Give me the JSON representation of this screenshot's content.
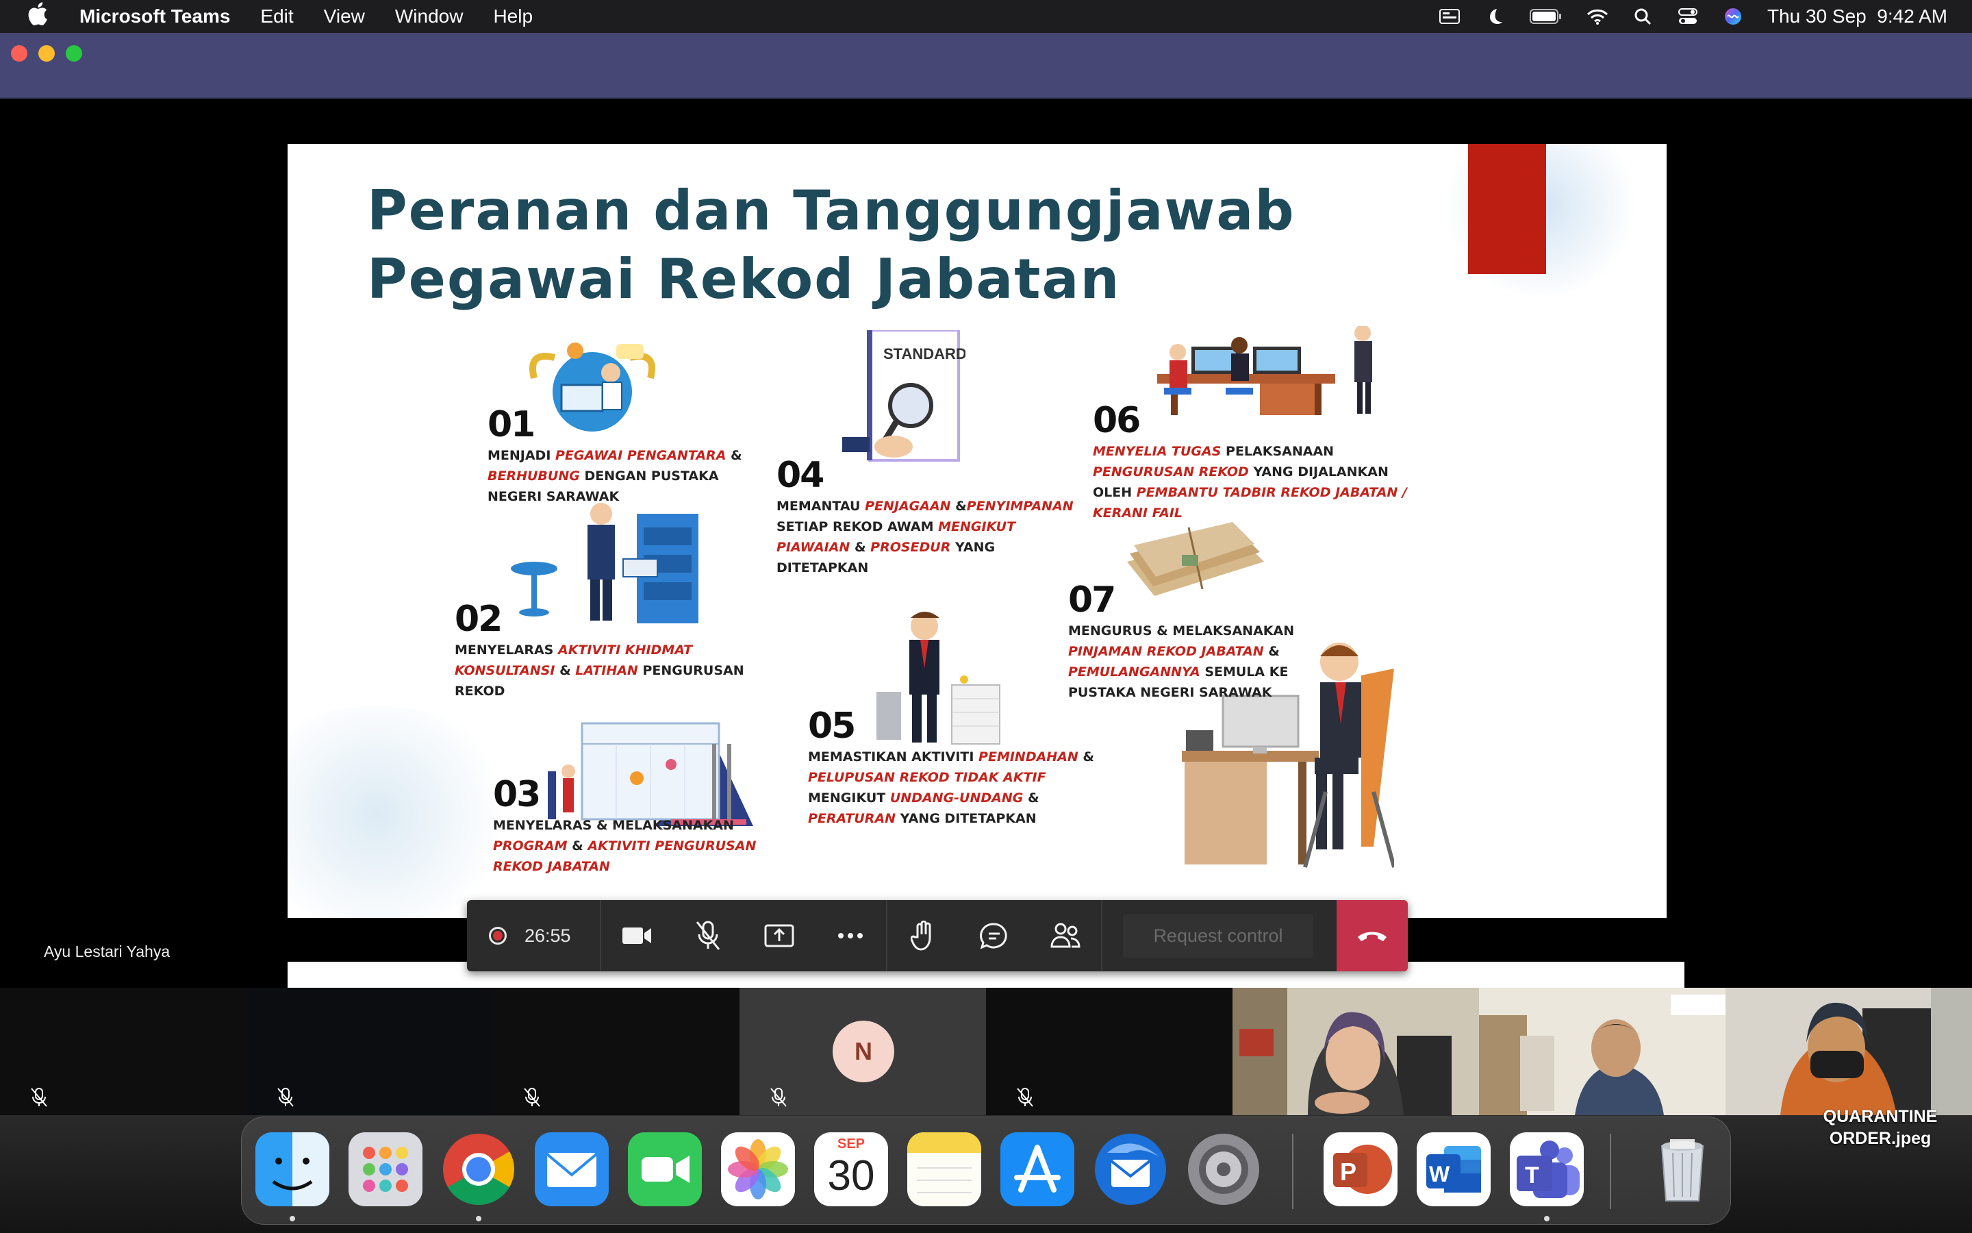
{
  "menubar": {
    "app_name": "Microsoft Teams",
    "menus": [
      "Edit",
      "View",
      "Window",
      "Help"
    ],
    "clock": "Thu 30 Sep  9:42 AM"
  },
  "slide": {
    "title_line1": "Peranan dan Tanggungjawab",
    "title_line2": "Pegawai Rekod Jabatan",
    "standard_label": "STANDARD",
    "items": [
      {
        "num": "01",
        "parts": [
          [
            "MENJADI ",
            0
          ],
          [
            "PEGAWAI PENGANTARA",
            1
          ],
          [
            " & ",
            0
          ],
          [
            "BERHUBUNG",
            1
          ],
          [
            " DENGAN PUSTAKA NEGERI SARAWAK",
            0
          ]
        ]
      },
      {
        "num": "02",
        "parts": [
          [
            "MENYELARAS ",
            0
          ],
          [
            "AKTIVITI KHIDMAT KONSULTANSI",
            1
          ],
          [
            " & ",
            0
          ],
          [
            "LATIHAN",
            1
          ],
          [
            " PENGURUSAN REKOD",
            0
          ]
        ]
      },
      {
        "num": "03",
        "parts": [
          [
            "MENYELARAS & MELAKSANAKAN ",
            0
          ],
          [
            "PROGRAM",
            1
          ],
          [
            " & ",
            0
          ],
          [
            "AKTIVITI PENGURUSAN REKOD JABATAN",
            1
          ]
        ]
      },
      {
        "num": "04",
        "parts": [
          [
            "MEMANTAU ",
            0
          ],
          [
            "PENJAGAAN",
            1
          ],
          [
            " &",
            0
          ],
          [
            "PENYIMPANAN",
            1
          ],
          [
            " SETIAP REKOD AWAM ",
            0
          ],
          [
            "MENGIKUT PIAWAIAN",
            1
          ],
          [
            " & ",
            0
          ],
          [
            "PROSEDUR",
            1
          ],
          [
            " YANG DITETAPKAN",
            0
          ]
        ]
      },
      {
        "num": "05",
        "parts": [
          [
            "MEMASTIKAN AKTIVITI ",
            0
          ],
          [
            "PEMINDAHAN",
            1
          ],
          [
            " & ",
            0
          ],
          [
            "PELUPUSAN REKOD TIDAK AKTIF",
            1
          ],
          [
            " MENGIKUT ",
            0
          ],
          [
            "UNDANG-UNDANG",
            1
          ],
          [
            " & ",
            0
          ],
          [
            "PERATURAN",
            1
          ],
          [
            " YANG DITETAPKAN",
            0
          ]
        ]
      },
      {
        "num": "06",
        "parts": [
          [
            "MENYELIA TUGAS",
            1
          ],
          [
            " PELAKSANAAN ",
            0
          ],
          [
            "PENGURUSAN REKOD",
            1
          ],
          [
            " YANG DIJALANKAN OLEH ",
            0
          ],
          [
            "PEMBANTU TADBIR REKOD JABATAN / KERANI FAIL",
            1
          ]
        ]
      },
      {
        "num": "07",
        "parts": [
          [
            "MENGURUS & MELAKSANAKAN ",
            0
          ],
          [
            "PINJAMAN REKOD JABATAN",
            1
          ],
          [
            " & ",
            0
          ],
          [
            "PEMULANGANNYA",
            1
          ],
          [
            " SEMULA KE PUSTAKA NEGERI SARAWAK",
            0
          ]
        ]
      }
    ]
  },
  "meeting": {
    "duration": "26:55",
    "request_control_label": "Request control",
    "presenter_name": "Ayu Lestari Yahya",
    "participant_initial": "N"
  },
  "dock": {
    "calendar_month": "SEP",
    "calendar_day": "30",
    "desktop_file_label": "QUARANTINE ORDER.jpeg"
  },
  "colors": {
    "accent_red": "#c4231b",
    "title_teal": "#1e4a5a",
    "teams_purple": "#464775",
    "hangup_red": "#c4314b"
  }
}
